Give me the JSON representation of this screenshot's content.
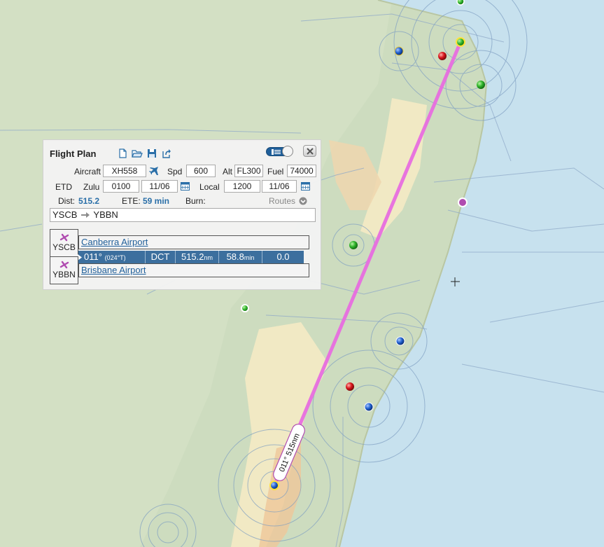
{
  "panel": {
    "title": "Flight Plan",
    "aircraft_label": "Aircraft",
    "aircraft_value": "XH558",
    "spd_label": "Spd",
    "spd_value": "600",
    "alt_label": "Alt",
    "alt_value": "FL300",
    "fuel_label": "Fuel",
    "fuel_value": "74000",
    "etd_label": "ETD",
    "zulu_label": "Zulu",
    "zulu_time": "0100",
    "zulu_date": "11/06",
    "local_label": "Local",
    "local_time": "1200",
    "local_date": "11/06",
    "dist_label": "Dist:",
    "dist_value": "515.2",
    "ete_label": "ETE:",
    "ete_value": "59 min",
    "burn_label": "Burn:",
    "routes_label": "Routes",
    "route_from": "YSCB",
    "route_to": "YBBN",
    "departure": {
      "code": "YSCB",
      "name": "Canberra Airport"
    },
    "arrival": {
      "code": "YBBN",
      "name": "Brisbane Airport"
    },
    "leg": {
      "track": "011°",
      "true_track": "(024°T)",
      "via": "DCT",
      "distance": "515.2",
      "distance_unit": "nm",
      "time": "58.8",
      "time_unit": "min",
      "fuel": "0.0"
    }
  },
  "map": {
    "route_label": "011° 515nm",
    "route_color": "#e86ee0"
  }
}
